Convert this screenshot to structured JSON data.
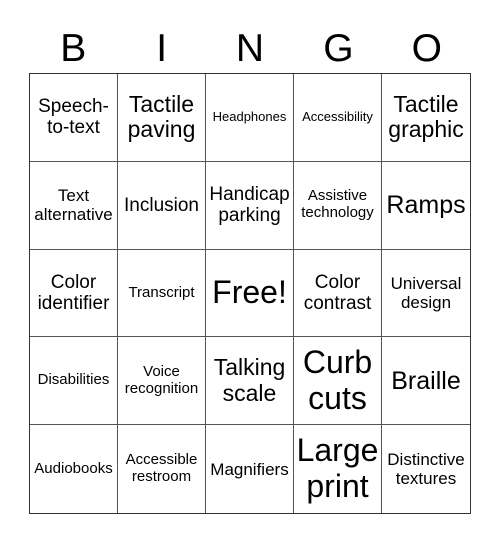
{
  "header": {
    "letters": [
      "B",
      "I",
      "N",
      "G",
      "O"
    ]
  },
  "cells": [
    "Speech-to-text",
    "Tactile paving",
    "Headphones",
    "Accessibility",
    "Tactile graphic",
    "Text alternative",
    "Inclusion",
    "Handicap parking",
    "Assistive technology",
    "Ramps",
    "Color identifier",
    "Transcript",
    "Free!",
    "Color contrast",
    "Universal design",
    "Disabilities",
    "Voice recognition",
    "Talking scale",
    "Curb cuts",
    "Braille",
    "Audiobooks",
    "Accessible restroom",
    "Magnifiers",
    "Large print",
    "Distinctive textures"
  ]
}
